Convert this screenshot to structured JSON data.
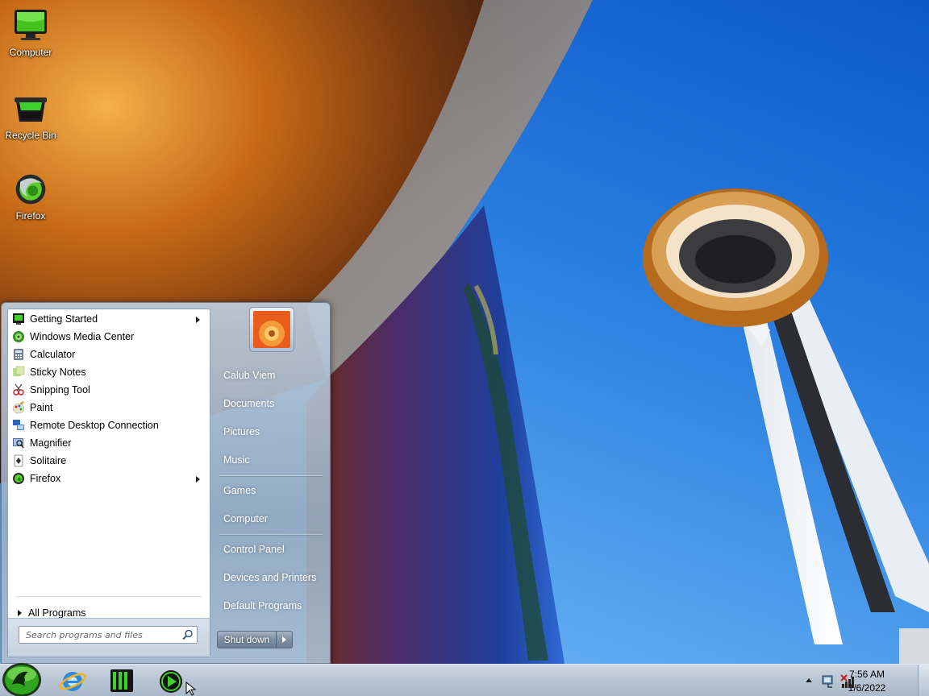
{
  "desktop": {
    "icons": [
      {
        "label": "Computer"
      },
      {
        "label": "Recycle Bin"
      },
      {
        "label": "Firefox"
      }
    ]
  },
  "start_menu": {
    "programs": [
      {
        "label": "Getting Started",
        "has_submenu": true,
        "icon": "getting-started-icon"
      },
      {
        "label": "Windows Media Center",
        "has_submenu": false,
        "icon": "media-center-icon"
      },
      {
        "label": "Calculator",
        "has_submenu": false,
        "icon": "calculator-icon"
      },
      {
        "label": "Sticky Notes",
        "has_submenu": false,
        "icon": "sticky-notes-icon"
      },
      {
        "label": "Snipping Tool",
        "has_submenu": false,
        "icon": "snipping-tool-icon"
      },
      {
        "label": "Paint",
        "has_submenu": false,
        "icon": "paint-icon"
      },
      {
        "label": "Remote Desktop Connection",
        "has_submenu": false,
        "icon": "remote-desktop-icon"
      },
      {
        "label": "Magnifier",
        "has_submenu": false,
        "icon": "magnifier-icon"
      },
      {
        "label": "Solitaire",
        "has_submenu": false,
        "icon": "solitaire-icon"
      },
      {
        "label": "Firefox",
        "has_submenu": true,
        "icon": "firefox-icon"
      }
    ],
    "all_programs_label": "All Programs",
    "search_placeholder": "Search programs and files",
    "right_links": {
      "user": "Calub Viem",
      "documents": "Documents",
      "pictures": "Pictures",
      "music": "Music",
      "games": "Games",
      "computer": "Computer",
      "control_panel": "Control Panel",
      "devices_printers": "Devices and Printers",
      "default_programs": "Default Programs"
    },
    "shutdown_label": "Shut down"
  },
  "taskbar": {
    "pinned": [
      "internet-explorer-icon",
      "razer-app-icon",
      "media-player-icon"
    ],
    "clock_time": "7:56 AM",
    "clock_date": "1/6/2022"
  },
  "colors": {
    "accent_green": "#3fd12b",
    "sky_blue": "#1f6fd6"
  }
}
